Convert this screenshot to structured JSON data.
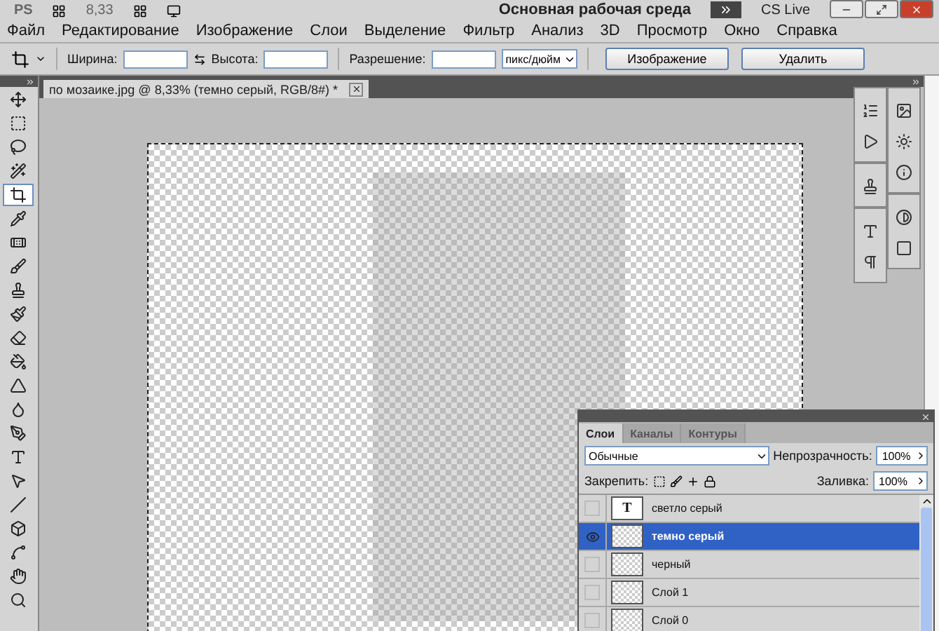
{
  "app_bar": {
    "logo": "PS",
    "zoom": "8,33",
    "workspace": "Основная рабочая среда",
    "cs_live": "CS Live"
  },
  "menu": [
    "Файл",
    "Редактирование",
    "Изображение",
    "Слои",
    "Выделение",
    "Фильтр",
    "Анализ",
    "3D",
    "Просмотр",
    "Окно",
    "Справка"
  ],
  "options": {
    "width_label": "Ширина:",
    "height_label": "Высота:",
    "resolution_label": "Разрешение:",
    "unit": "пикс/дюйм",
    "buttons": [
      "Изображение",
      "Удалить"
    ]
  },
  "tools": [
    {
      "selected": false
    },
    {
      "selected": false
    },
    {
      "selected": false
    },
    {
      "selected": false
    },
    {
      "selected": true
    },
    {
      "selected": false
    },
    {
      "selected": false
    },
    {
      "selected": false
    },
    {
      "selected": false
    },
    {
      "selected": false
    },
    {
      "selected": false
    },
    {
      "selected": false
    },
    {
      "selected": false
    },
    {
      "selected": false
    },
    {
      "selected": false
    },
    {
      "selected": false
    },
    {
      "selected": false
    },
    {
      "selected": false
    },
    {
      "selected": false
    },
    {
      "selected": false
    },
    {
      "selected": false
    },
    {
      "selected": false
    }
  ],
  "document_tab": {
    "title": "по мозаике.jpg @ 8,33% (темно серый, RGB/8#) *"
  },
  "layers_panel": {
    "tabs": [
      {
        "label": "Слои",
        "selected": true
      },
      {
        "label": "Каналы",
        "selected": false
      },
      {
        "label": "Контуры",
        "selected": false
      }
    ],
    "blend_mode": "Обычные",
    "opacity_label": "Непрозрачность:",
    "opacity": "100%",
    "lock_label": "Закрепить:",
    "fill_label": "Заливка:",
    "fill": "100%",
    "layers": [
      {
        "name": "светло серый",
        "kind": "text",
        "thumb": "T",
        "visible": false,
        "selected": false
      },
      {
        "name": "темно серый",
        "kind": "image",
        "visible": true,
        "selected": true
      },
      {
        "name": "черный",
        "kind": "image",
        "visible": false,
        "selected": false
      },
      {
        "name": "Слой 1",
        "kind": "image",
        "visible": false,
        "selected": false
      },
      {
        "name": "Слой 0",
        "kind": "image",
        "visible": false,
        "selected": false
      }
    ]
  }
}
